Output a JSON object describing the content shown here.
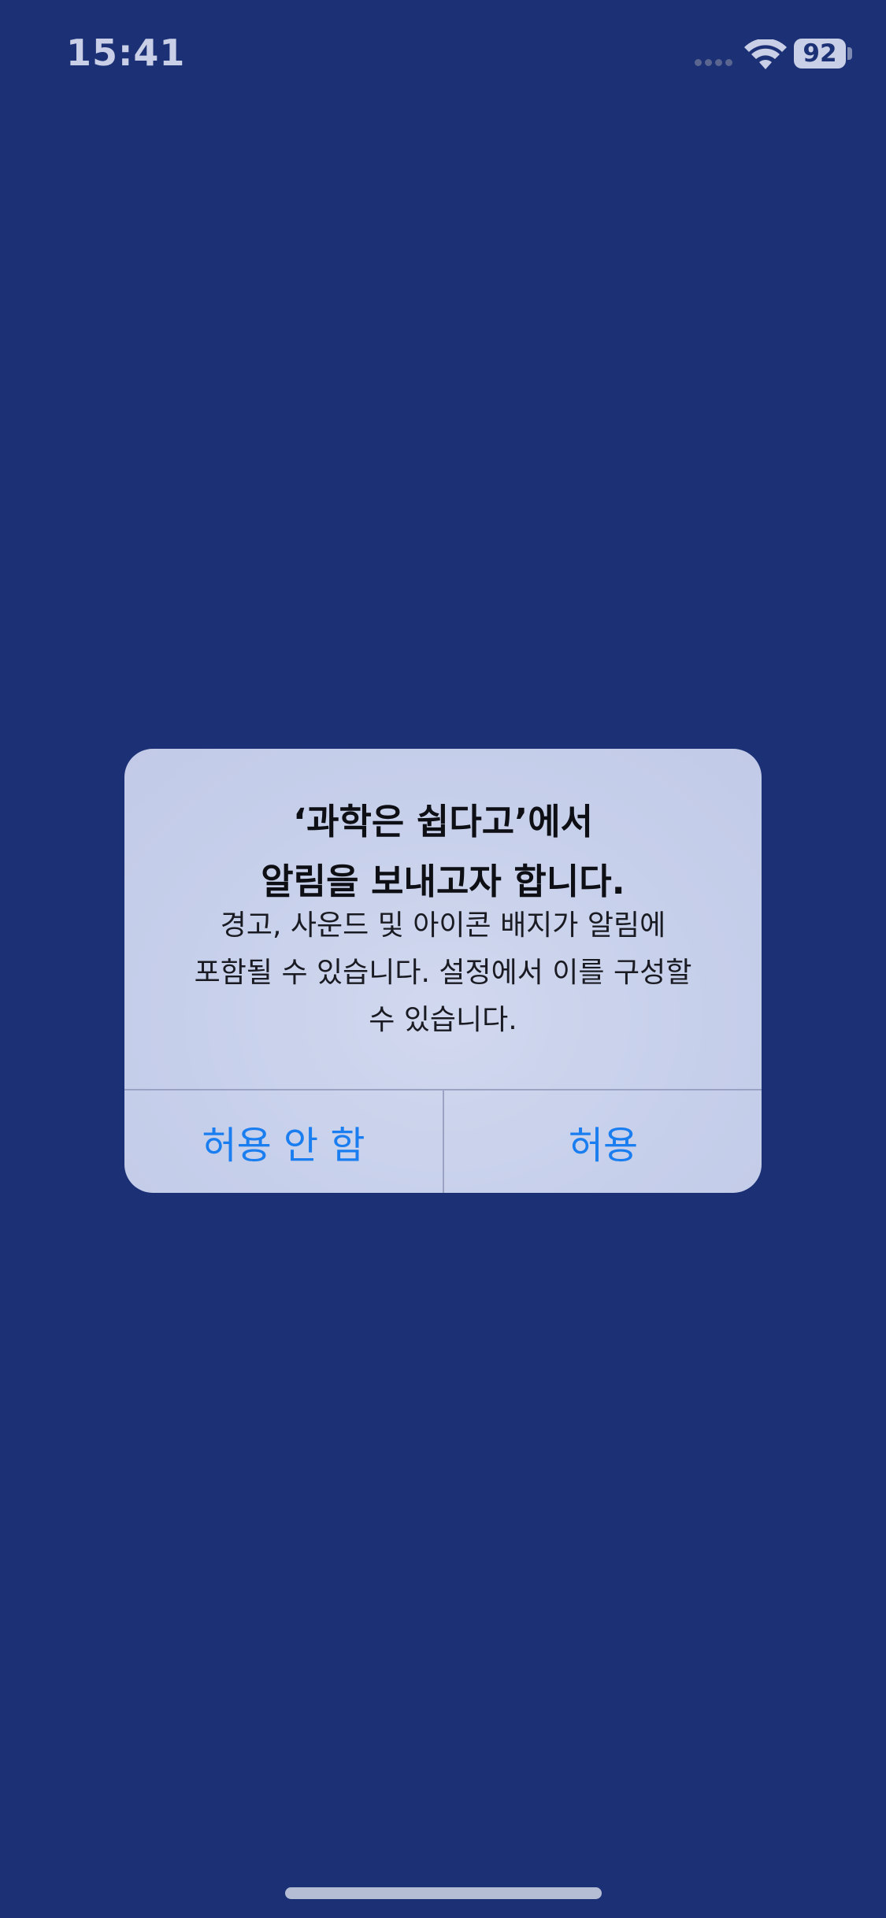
{
  "status_bar": {
    "time": "15:41",
    "battery_level": "92",
    "icons": [
      "cellular-signal-icon",
      "wifi-icon",
      "battery-icon"
    ]
  },
  "alert": {
    "title_lines": [
      "‘과학은 쉽다고’에서",
      "알림을 보내고자 합니다."
    ],
    "message_lines": [
      "경고, 사운드 및 아이콘 배지가 알림에",
      "포함될 수 있습니다. 설정에서 이를 구성할",
      "수 있습니다."
    ],
    "buttons": {
      "deny": "허용 안 함",
      "allow": "허용"
    }
  },
  "colors": {
    "background": "#1b3075",
    "alert_background": "#c6cfea",
    "button_text": "#1a7ef0"
  }
}
